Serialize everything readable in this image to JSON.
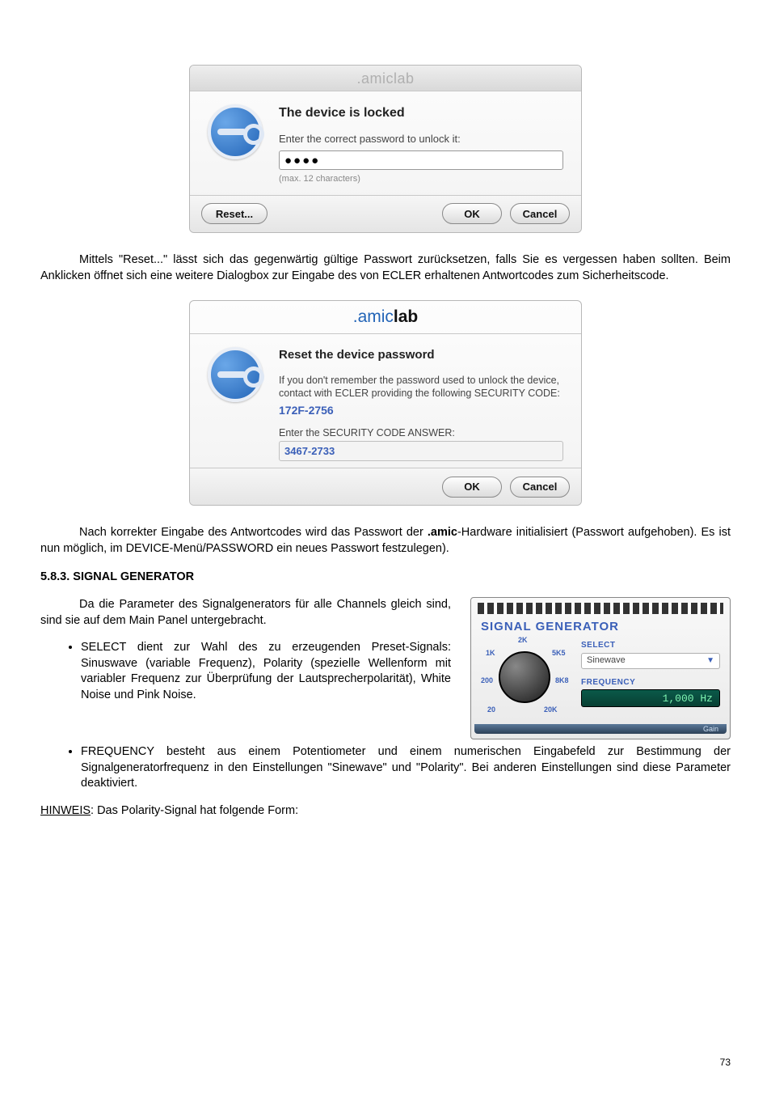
{
  "dialogs": {
    "lock": {
      "titlebar": ".amiclab",
      "title": "The device is locked",
      "prompt": "Enter the correct password to unlock it:",
      "password_value": "●●●●",
      "hint": "(max. 12 characters)",
      "reset": "Reset...",
      "ok": "OK",
      "cancel": "Cancel"
    },
    "reset": {
      "brand_amic": ".amic",
      "brand_lab": "lab",
      "title": "Reset the device password",
      "info": "If you don't remember the password used to unlock the device, contact with ECLER providing the following SECURITY CODE:",
      "security_code": "172F-2756",
      "answer_label": "Enter the SECURITY CODE ANSWER:",
      "answer_value": "3467-2733",
      "ok": "OK",
      "cancel": "Cancel"
    }
  },
  "paragraphs": {
    "p1": "Mittels \"Reset...\" lässt sich das gegenwärtig gültige Passwort zurücksetzen, falls Sie es vergessen haben sollten. Beim Anklicken öffnet sich eine weitere Dialogbox zur Eingabe des von ECLER erhaltenen Antwortcodes zum Sicherheitscode.",
    "p2_a": "Nach korrekter Eingabe des Antwortcodes wird das Passwort der ",
    "p2_b": ".amic",
    "p2_c": "-Hardware initialisiert (Passwort aufgehoben). Es ist nun möglich, im DEVICE-Menü/PASSWORD ein neues Passwort festzulegen).",
    "heading": "5.8.3. SIGNAL GENERATOR",
    "p3": "Da die Parameter des Signalgenerators für alle Channels gleich sind, sind sie auf dem Main Panel untergebracht.",
    "li1": "SELECT dient zur Wahl des zu erzeugenden Preset-Signals: Sinuswave (variable Frequenz), Polarity (spezielle Wellenform mit variabler Frequenz zur Überprüfung der Lautsprecherpolarität), White Noise und Pink Noise.",
    "li2": "FREQUENCY besteht aus einem Potentiometer und einem numerischen Eingabefeld zur Bestimmung der Signalgeneratorfrequenz in den Einstellungen \"Sinewave\" und \"Polarity\". Bei anderen Einstellungen sind diese Parameter deaktiviert.",
    "hinweis_label": "HINWEIS",
    "hinweis_rest": ": Das Polarity-Signal hat folgende Form:"
  },
  "sig_panel": {
    "title": "SIGNAL GENERATOR",
    "ticks": {
      "t20": "20",
      "t200": "200",
      "t1k": "1K",
      "t2k": "2K",
      "t5k5": "5K5",
      "t8k8": "8K8",
      "t20k": "20K"
    },
    "select_label": "SELECT",
    "select_value": "Sinewave",
    "freq_label": "FREQUENCY",
    "freq_value": "1,000 Hz",
    "footer": "Gain"
  },
  "page_number": "73"
}
